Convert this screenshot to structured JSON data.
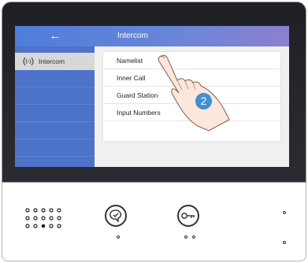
{
  "header": {
    "back_icon": "left-arrow-icon",
    "title": "Intercom"
  },
  "sidebar": {
    "items": [
      {
        "label": "Intercom",
        "icon": "intercom-icon",
        "active": true
      }
    ]
  },
  "menu": {
    "items": [
      {
        "label": "Namelist"
      },
      {
        "label": "Inner Call"
      },
      {
        "label": "Guard Station"
      },
      {
        "label": "Input Numbers"
      }
    ]
  },
  "annotation": {
    "step": "2"
  },
  "hardware": {
    "buttons": [
      {
        "icon": "talk-icon"
      },
      {
        "icon": "key-unlock-icon"
      }
    ]
  },
  "colors": {
    "accent": "#4f7ddb",
    "sidebar": "#4c72c9",
    "step_badge": "#3f8ed8"
  }
}
